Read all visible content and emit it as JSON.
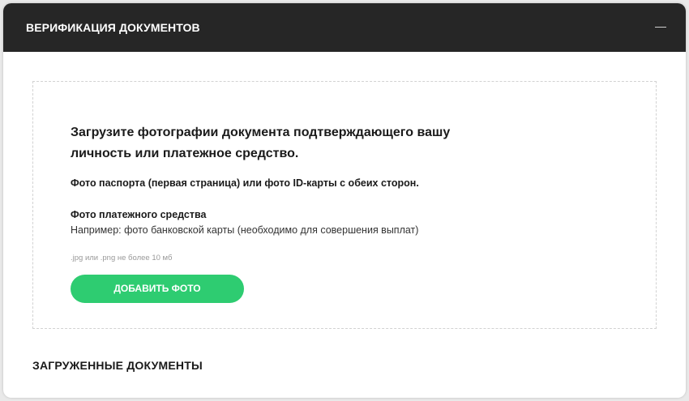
{
  "header": {
    "title": "ВЕРИФИКАЦИЯ ДОКУМЕНТОВ",
    "collapse_icon": "minus-icon"
  },
  "upload": {
    "heading": "Загрузите фотографии документа подтверждающего вашу личность или платежное средство.",
    "passport_text": "Фото паспорта (первая страница) или фото ID-карты с обеих сторон.",
    "payment_title": "Фото платежного средства",
    "payment_example": "Например: фото банковской карты (необходимо для совершения выплат)",
    "file_hint": ".jpg или .png не более 10 мб",
    "add_button_label": "ДОБАВИТЬ ФОТО"
  },
  "uploaded": {
    "title": "ЗАГРУЖЕННЫЕ ДОКУМЕНТЫ"
  },
  "colors": {
    "header_bg": "#262626",
    "accent_green": "#2ecc71"
  }
}
